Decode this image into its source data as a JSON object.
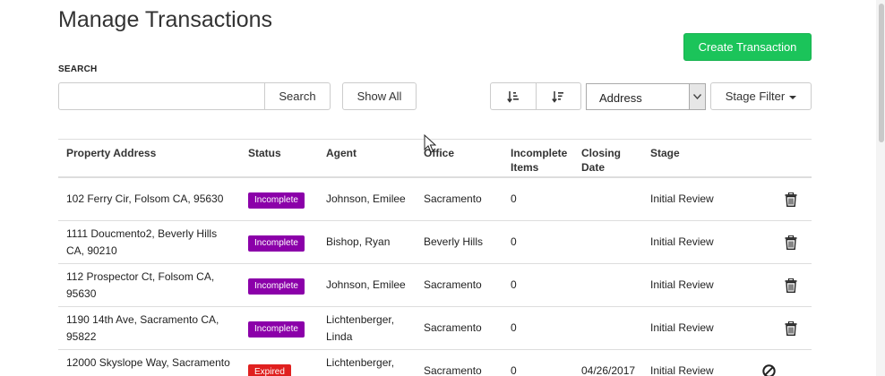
{
  "page": {
    "title": "Manage Transactions"
  },
  "toolbar": {
    "create_label": "Create Transaction",
    "search_label": "SEARCH",
    "search_value": "",
    "search_button": "Search",
    "show_all_button": "Show All",
    "sort_field_value": "Address",
    "stage_filter_label": "Stage Filter"
  },
  "colors": {
    "primary_green": "#1bc45a",
    "incomplete": "#8b00a9",
    "expired": "#e0201f"
  },
  "table": {
    "columns": [
      "Property Address",
      "Status",
      "Agent",
      "Office",
      "Incomplete\nItems",
      "Closing\nDate",
      "Stage"
    ],
    "rows": [
      {
        "address": "102 Ferry Cir, Folsom CA, 95630",
        "status": "Incomplete",
        "agent": "Johnson, Emilee",
        "office": "Sacramento",
        "incomplete_items": "0",
        "closing_date": "",
        "stage": "Initial Review",
        "action_icon": "trash-icon"
      },
      {
        "address": "1111 Doucmento2, Beverly Hills CA, 90210",
        "status": "Incomplete",
        "agent": "Bishop, Ryan",
        "office": "Beverly Hills",
        "incomplete_items": "0",
        "closing_date": "",
        "stage": "Initial Review",
        "action_icon": "trash-icon"
      },
      {
        "address": "112 Prospector Ct, Folsom CA, 95630",
        "status": "Incomplete",
        "agent": "Johnson, Emilee",
        "office": "Sacramento",
        "incomplete_items": "0",
        "closing_date": "",
        "stage": "Initial Review",
        "action_icon": "trash-icon"
      },
      {
        "address": "1190 14th Ave, Sacramento CA, 95822",
        "status": "Incomplete",
        "agent": "Lichtenberger, Linda",
        "office": "Sacramento",
        "incomplete_items": "0",
        "closing_date": "",
        "stage": "Initial Review",
        "action_icon": "trash-icon"
      },
      {
        "address": "12000 Skyslope Way, Sacramento",
        "status": "Expired",
        "agent": "Lichtenberger,",
        "office": "Sacramento",
        "incomplete_items": "0",
        "closing_date": "04/26/2017",
        "stage": "Initial Review",
        "action_icon": "cancel-icon"
      }
    ]
  }
}
